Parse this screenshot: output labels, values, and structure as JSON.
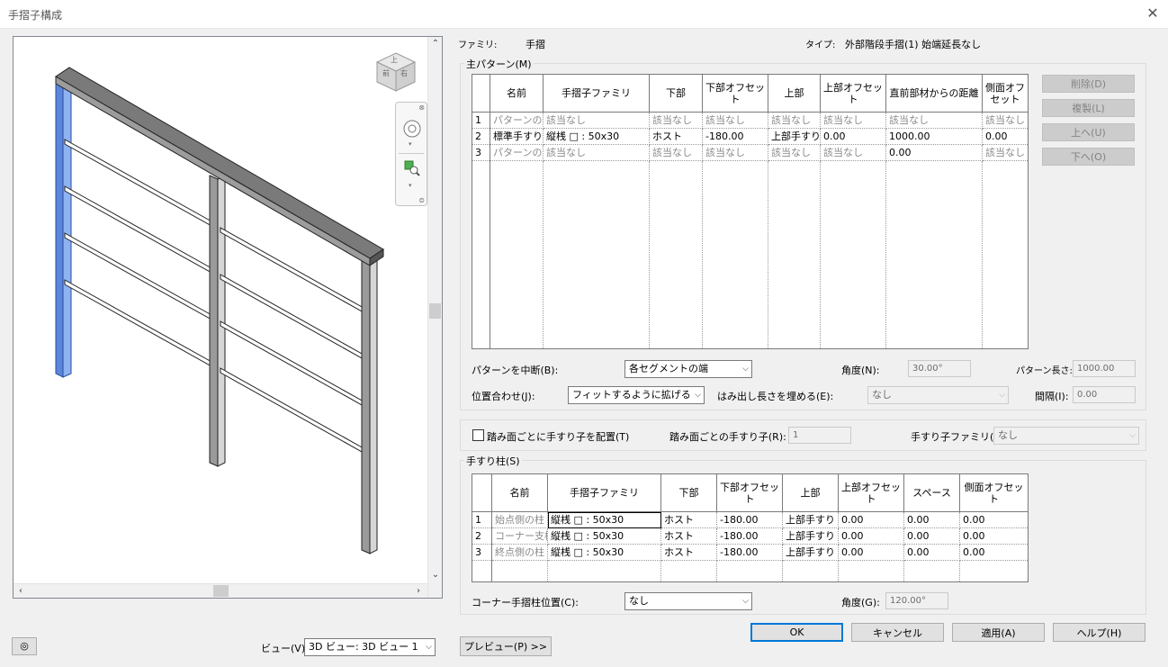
{
  "window": {
    "title": "手摺子構成"
  },
  "view": {
    "label": "ビュー(V):",
    "selected": "3D ビュー: 3D ビュー 1"
  },
  "cube": {
    "top": "上",
    "front": "前",
    "right": "右"
  },
  "preview_button": "プレビュー(P) >>",
  "family": {
    "label": "ファミリ:",
    "value": "手摺"
  },
  "type": {
    "label": "タイプ:",
    "value": "外部階段手摺(1) 始端延長なし"
  },
  "main_pattern": {
    "title": "主パターン(M)",
    "headers": [
      "名前",
      "手摺子ファミリ",
      "下部",
      "下部オフセット",
      "上部",
      "上部オフセット",
      "直前部材からの距離",
      "側面オフセット"
    ],
    "rows": [
      {
        "no": "1",
        "cells": [
          "パターンの",
          "該当なし",
          "該当なし",
          "該当なし",
          "該当なし",
          "該当なし",
          "該当なし",
          "該当なし"
        ]
      },
      {
        "no": "2",
        "cells": [
          "標準手すり",
          "縦桟 □ : 50x30",
          "ホスト",
          "-180.00",
          "上部手すり",
          "0.00",
          "1000.00",
          "0.00"
        ]
      },
      {
        "no": "3",
        "cells": [
          "パターンの",
          "該当なし",
          "該当なし",
          "該当なし",
          "該当なし",
          "該当なし",
          "0.00",
          "該当なし"
        ]
      }
    ],
    "buttons": {
      "delete": "削除(D)",
      "duplicate": "複製(L)",
      "up": "上へ(U)",
      "down": "下へ(O)"
    },
    "break_label": "パターンを中断(B):",
    "break_value": "各セグメントの端",
    "angle_label": "角度(N):",
    "angle_value": "30.00°",
    "length_label": "パターン長さ:",
    "length_value": "1000.00",
    "justify_label": "位置合わせ(J):",
    "justify_value": "フィットするように拡げる",
    "fill_label": "はみ出し長さを埋める(E):",
    "fill_value": "なし",
    "spacing_label": "間隔(I):",
    "spacing_value": "0.00"
  },
  "tread": {
    "checkbox_label": "踏み面ごとに手すり子を配置(T)",
    "per_tread_label": "踏み面ごとの手すり子(R):",
    "per_tread_value": "1",
    "family_label": "手すり子ファミリ(F):",
    "family_value": "なし"
  },
  "posts": {
    "title": "手すり柱(S)",
    "headers": [
      "名前",
      "手摺子ファミリ",
      "下部",
      "下部オフセット",
      "上部",
      "上部オフセット",
      "スペース",
      "側面オフセット"
    ],
    "rows": [
      {
        "no": "1",
        "cells": [
          "始点側の柱",
          "縦桟 □ : 50x30",
          "ホスト",
          "-180.00",
          "上部手すり",
          "0.00",
          "0.00",
          "0.00"
        ]
      },
      {
        "no": "2",
        "cells": [
          "コーナー支柱",
          "縦桟 □ : 50x30",
          "ホスト",
          "-180.00",
          "上部手すり",
          "0.00",
          "0.00",
          "0.00"
        ]
      },
      {
        "no": "3",
        "cells": [
          "終点側の柱",
          "縦桟 □ : 50x30",
          "ホスト",
          "-180.00",
          "上部手すり",
          "0.00",
          "0.00",
          "0.00"
        ]
      }
    ],
    "corner_label": "コーナー手摺柱位置(C):",
    "corner_value": "なし",
    "angle_label": "角度(G):",
    "angle_value": "120.00°"
  },
  "footer": {
    "ok": "OK",
    "cancel": "キャンセル",
    "apply": "適用(A)",
    "help": "ヘルプ(H)"
  },
  "colors": {
    "accent": "#0078d7",
    "selected_post": "#6f9be8"
  }
}
